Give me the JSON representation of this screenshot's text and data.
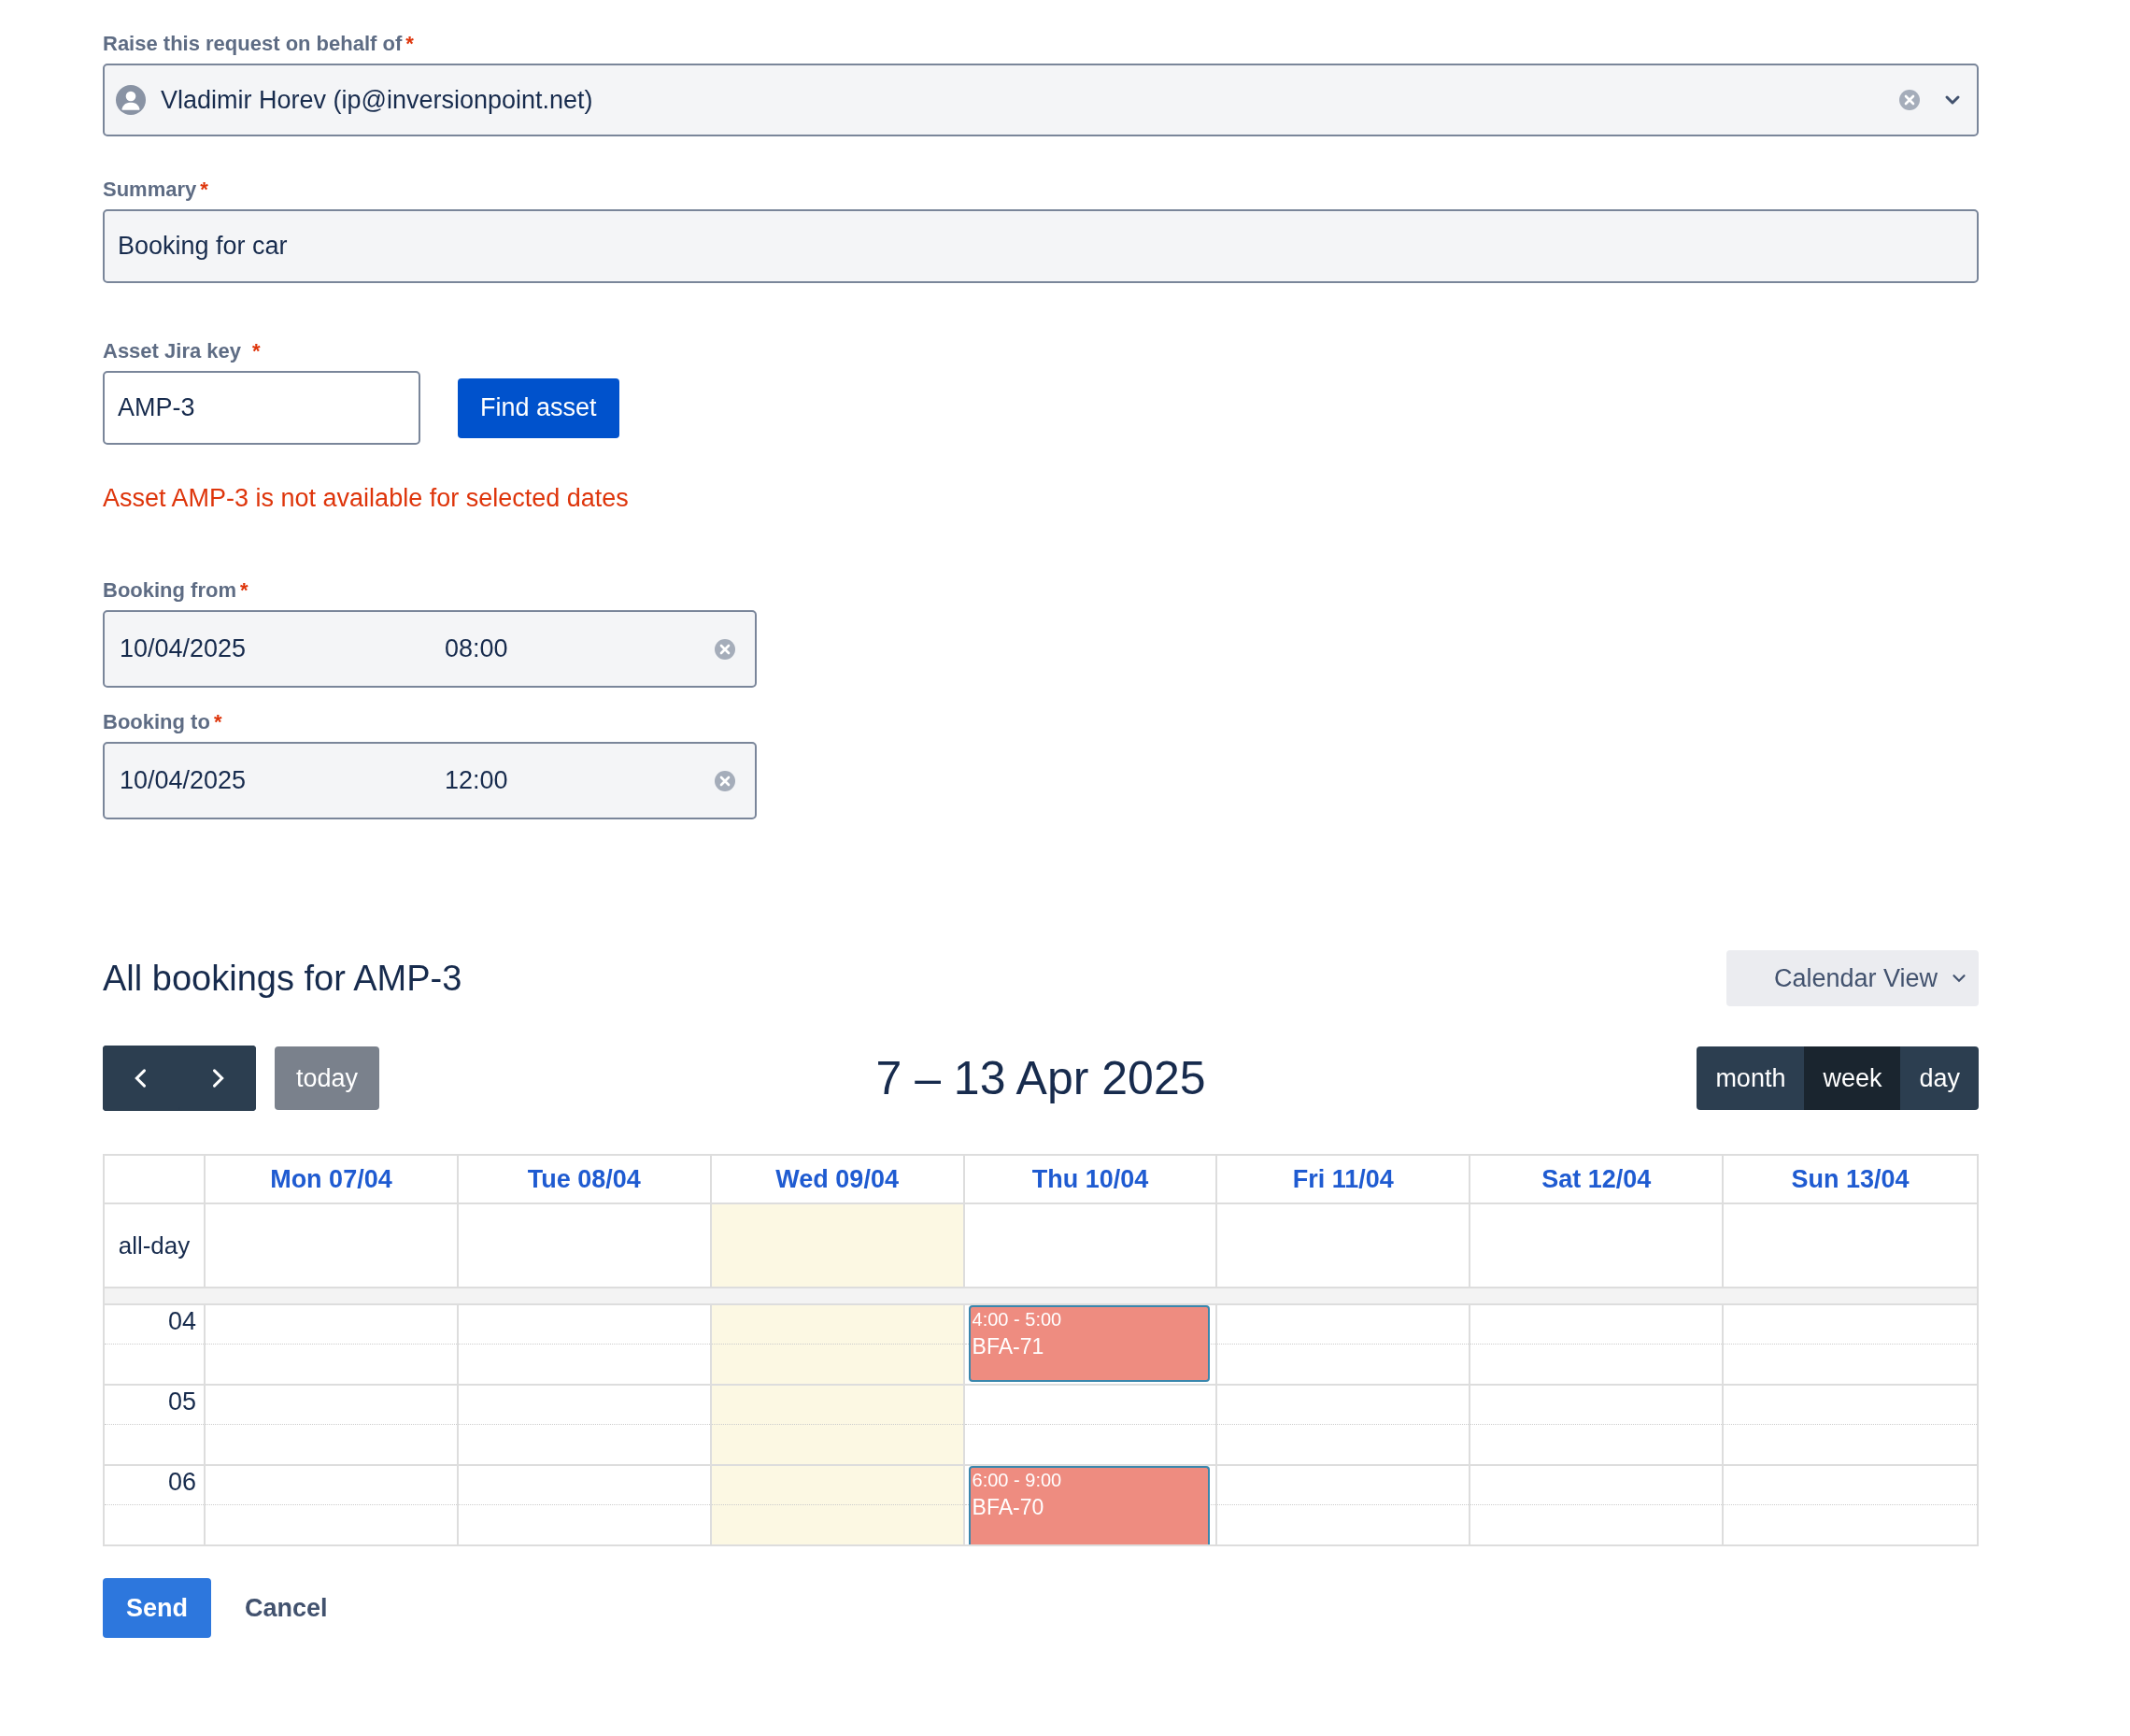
{
  "required_mark": "*",
  "requester": {
    "label": "Raise this request on behalf of",
    "required": true,
    "value": "Vladimir Horev (ip@inversionpoint.net)"
  },
  "summary": {
    "label": "Summary",
    "required": true,
    "value": "Booking for car"
  },
  "asset": {
    "label": "Asset Jira key",
    "required": true,
    "value": "AMP-3",
    "button": "Find asset",
    "error": "Asset AMP-3 is not available for selected dates"
  },
  "booking_from": {
    "label": "Booking from",
    "required": true,
    "date": "10/04/2025",
    "time": "08:00"
  },
  "booking_to": {
    "label": "Booking to",
    "required": true,
    "date": "10/04/2025",
    "time": "12:00"
  },
  "bookings": {
    "heading": "All bookings for AMP-3",
    "view_select": "Calendar View",
    "today_button": "today",
    "range_title": "7 – 13 Apr 2025",
    "views": [
      {
        "label": "month",
        "selected": false
      },
      {
        "label": "week",
        "selected": true
      },
      {
        "label": "day",
        "selected": false
      }
    ],
    "allday_label": "all-day",
    "days": [
      {
        "label": "Mon 07/04",
        "today": false
      },
      {
        "label": "Tue 08/04",
        "today": false
      },
      {
        "label": "Wed 09/04",
        "today": true
      },
      {
        "label": "Thu 10/04",
        "today": false
      },
      {
        "label": "Fri 11/04",
        "today": false
      },
      {
        "label": "Sat 12/04",
        "today": false
      },
      {
        "label": "Sun 13/04",
        "today": false
      }
    ],
    "hours": [
      {
        "label": "04",
        "cells": [
          null,
          null,
          null,
          {
            "time": "4:00 - 5:00",
            "title": "BFA-71"
          },
          null,
          null,
          null
        ]
      },
      {
        "label": "05",
        "cells": [
          null,
          null,
          null,
          null,
          null,
          null,
          null
        ]
      },
      {
        "label": "06",
        "cells": [
          null,
          null,
          null,
          {
            "time": "6:00 - 9:00",
            "title": "BFA-70"
          },
          null,
          null,
          null
        ]
      }
    ]
  },
  "actions": {
    "send": "Send",
    "cancel": "Cancel"
  }
}
